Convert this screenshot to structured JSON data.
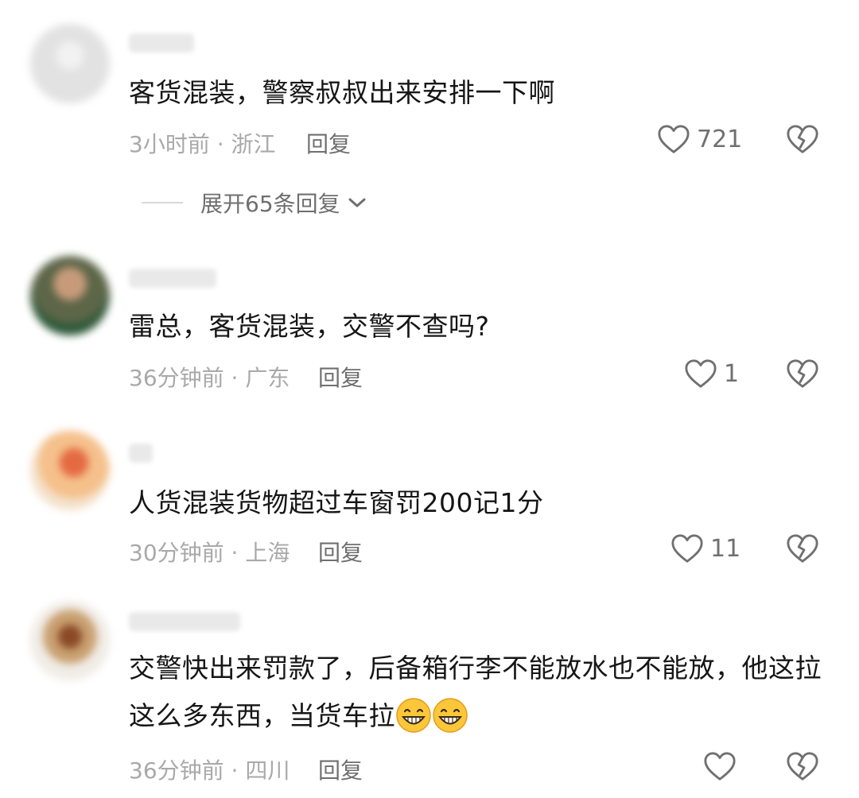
{
  "comments": [
    {
      "avatar_color": "#e2e2e2",
      "text": "客货混装，警察叔叔出来安排一下啊",
      "meta": "3小时前 · 浙江",
      "reply_label": "回复",
      "likes": "721",
      "expand_label": "展开65条回复"
    },
    {
      "avatar_color": "#6b6a55",
      "text": "雷总，客货混装，交警不查吗?",
      "meta": "36分钟前 · 广东",
      "reply_label": "回复",
      "likes": "1"
    },
    {
      "avatar_color": "#f1a86c",
      "text": "人货混装货物超过车窗罚200记1分",
      "meta": "30分钟前 · 上海",
      "reply_label": "回复",
      "likes": "11"
    },
    {
      "avatar_color": "#c9a070",
      "text_line1": "交警快出来罚款了，后备箱行李不能放水也不能放，他这拉",
      "text_line2": "这么多东西，当货车拉",
      "emoji": "grinning-face-emoji",
      "meta": "36分钟前 · 四川",
      "reply_label": "回复",
      "likes": ""
    }
  ],
  "colors": {
    "text": "#161616",
    "meta": "#a9a9a9",
    "action": "#6f6f6f",
    "icon": "#707070"
  },
  "icons": {
    "like": "heart-outline-icon",
    "dislike": "broken-heart-icon",
    "expand": "chevron-down-icon"
  }
}
